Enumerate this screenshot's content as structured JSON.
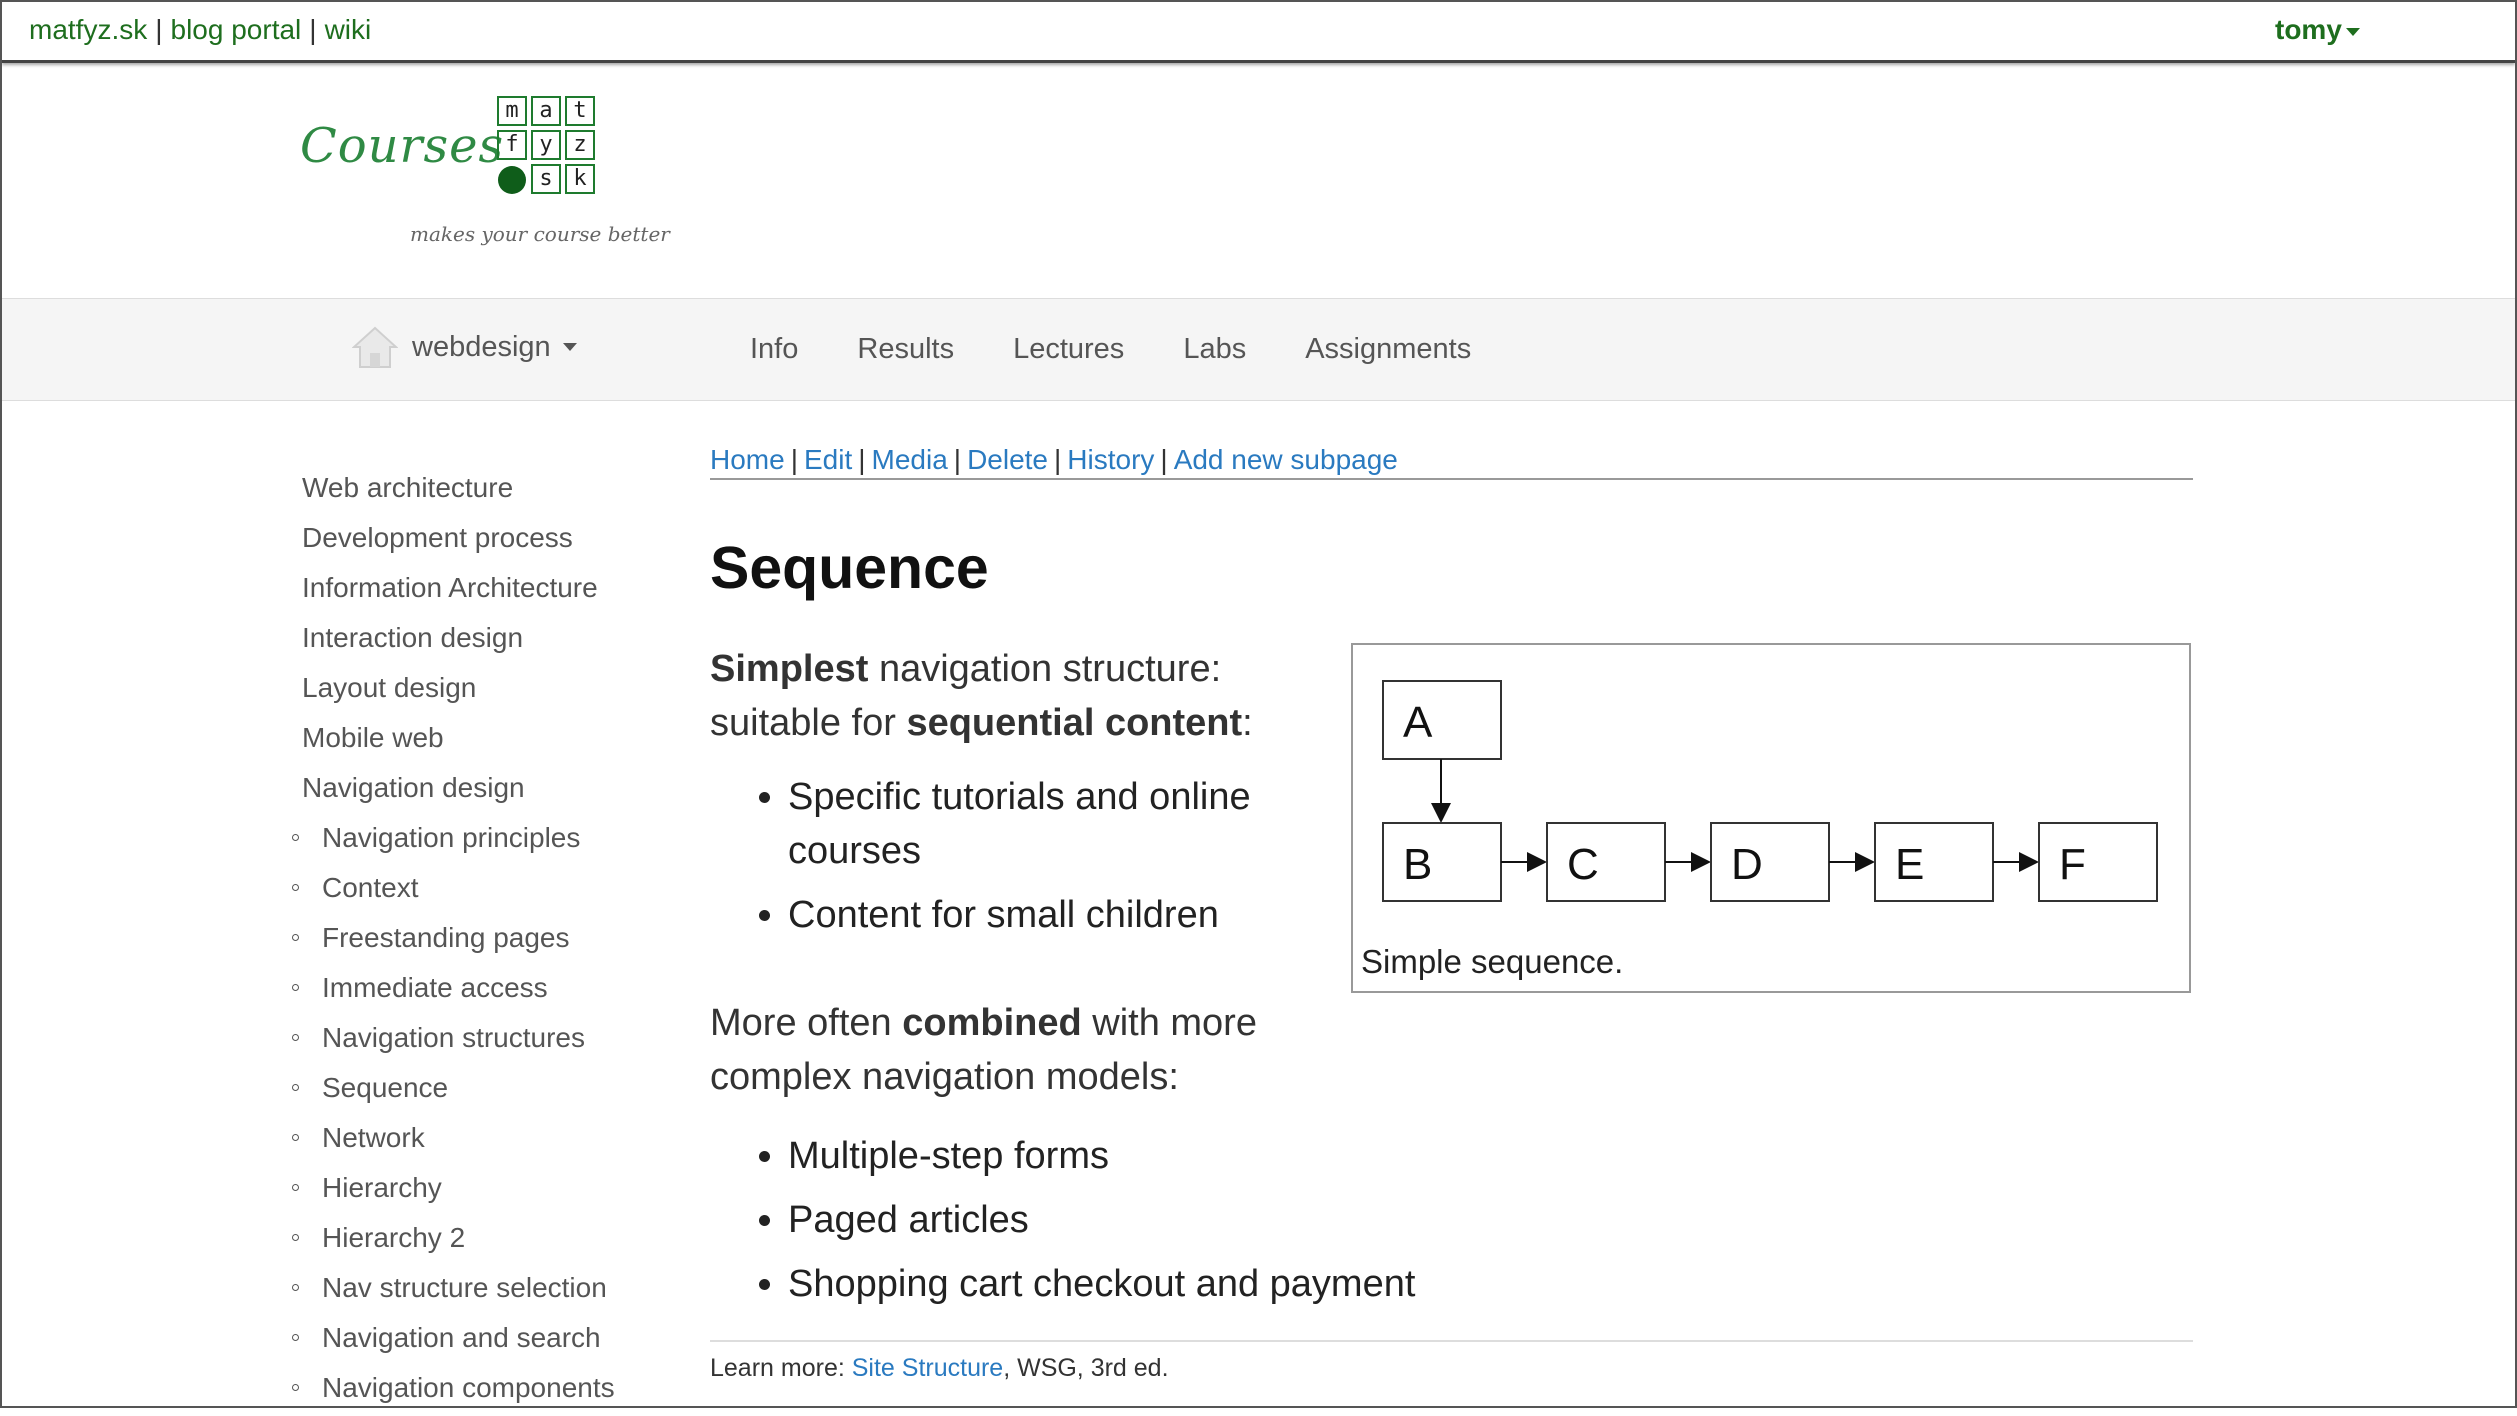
{
  "topbar": {
    "links": [
      "matfyz.sk",
      "blog portal",
      "wiki"
    ],
    "user": "tomy"
  },
  "logo": {
    "text": "Courses",
    "grid": [
      "m",
      "a",
      "t",
      "f",
      "y",
      "z",
      "s",
      "k"
    ],
    "tagline": "makes your course better"
  },
  "nav": {
    "course": "webdesign",
    "tabs": [
      "Info",
      "Results",
      "Lectures",
      "Labs",
      "Assignments"
    ]
  },
  "sidebar": {
    "top_items": [
      "Web architecture",
      "Development process",
      "Information Architecture",
      "Interaction design",
      "Layout design",
      "Mobile web",
      "Navigation design"
    ],
    "sub_items": [
      "Navigation principles",
      "Context",
      "Freestanding pages",
      "Immediate access",
      "Navigation structures",
      "Sequence",
      "Network",
      "Hierarchy",
      "Hierarchy 2",
      "Nav structure selection",
      "Navigation and search",
      "Navigation components"
    ]
  },
  "page_actions": [
    "Home",
    "Edit",
    "Media",
    "Delete",
    "History",
    "Add new subpage"
  ],
  "content": {
    "title": "Sequence",
    "p1": {
      "bold1": "Simplest",
      "text1": " navigation structure: suitable for ",
      "bold2": "sequential content",
      "text2": ":"
    },
    "list1": [
      "Specific tutorials and online courses",
      "Content for small children"
    ],
    "p2": {
      "text1": "More often ",
      "bold": "combined",
      "text2": " with more complex navigation models:"
    },
    "list2": [
      "Multiple-step forms",
      "Paged articles",
      "Shopping cart checkout and payment"
    ]
  },
  "figure": {
    "nodes": [
      "A",
      "B",
      "C",
      "D",
      "E",
      "F"
    ],
    "caption": "Simple sequence."
  },
  "learn_more": {
    "prefix": "Learn more: ",
    "link": "Site Structure",
    "suffix": ", WSG, 3rd ed."
  }
}
